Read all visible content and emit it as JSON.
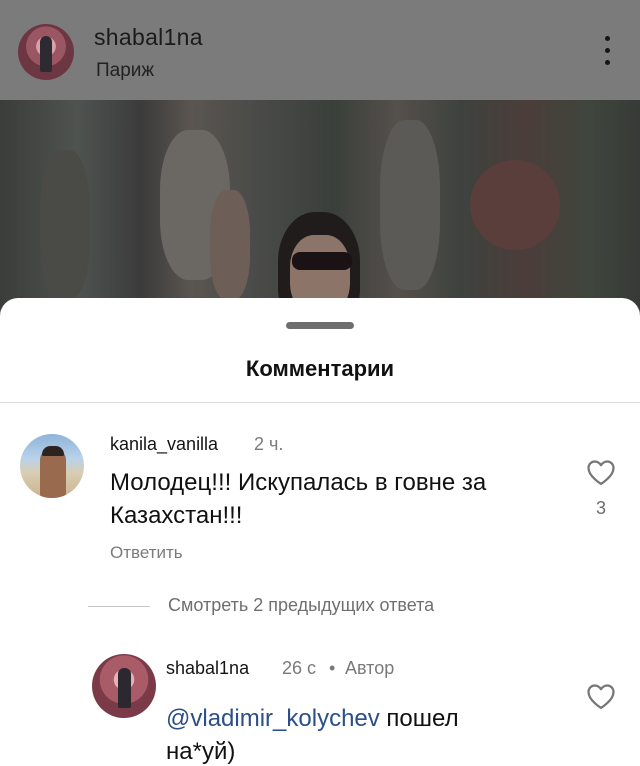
{
  "post": {
    "author": "shabal1na",
    "location": "Париж"
  },
  "sheet": {
    "title": "Комментарии"
  },
  "comments": [
    {
      "username": "kanila_vanilla",
      "time": "2 ч.",
      "text": "Молодец!!! Искупалась в говне за Казахстан!!!",
      "likes": "3",
      "reply_label": "Ответить",
      "view_replies": "Смотреть 2 предыдущих ответа",
      "replies": [
        {
          "username": "shabal1na",
          "time": "26 с",
          "separator": "•",
          "author_tag": "Автор",
          "mention": "@vladimir_kolychev",
          "text": " пошел на*уй)"
        }
      ]
    }
  ],
  "icons": {
    "more": "more-vertical-icon",
    "like": "heart-outline-icon"
  },
  "colors": {
    "mention": "#2b4f86",
    "overlay": "#5e5e5e",
    "sheet": "#ffffff"
  }
}
